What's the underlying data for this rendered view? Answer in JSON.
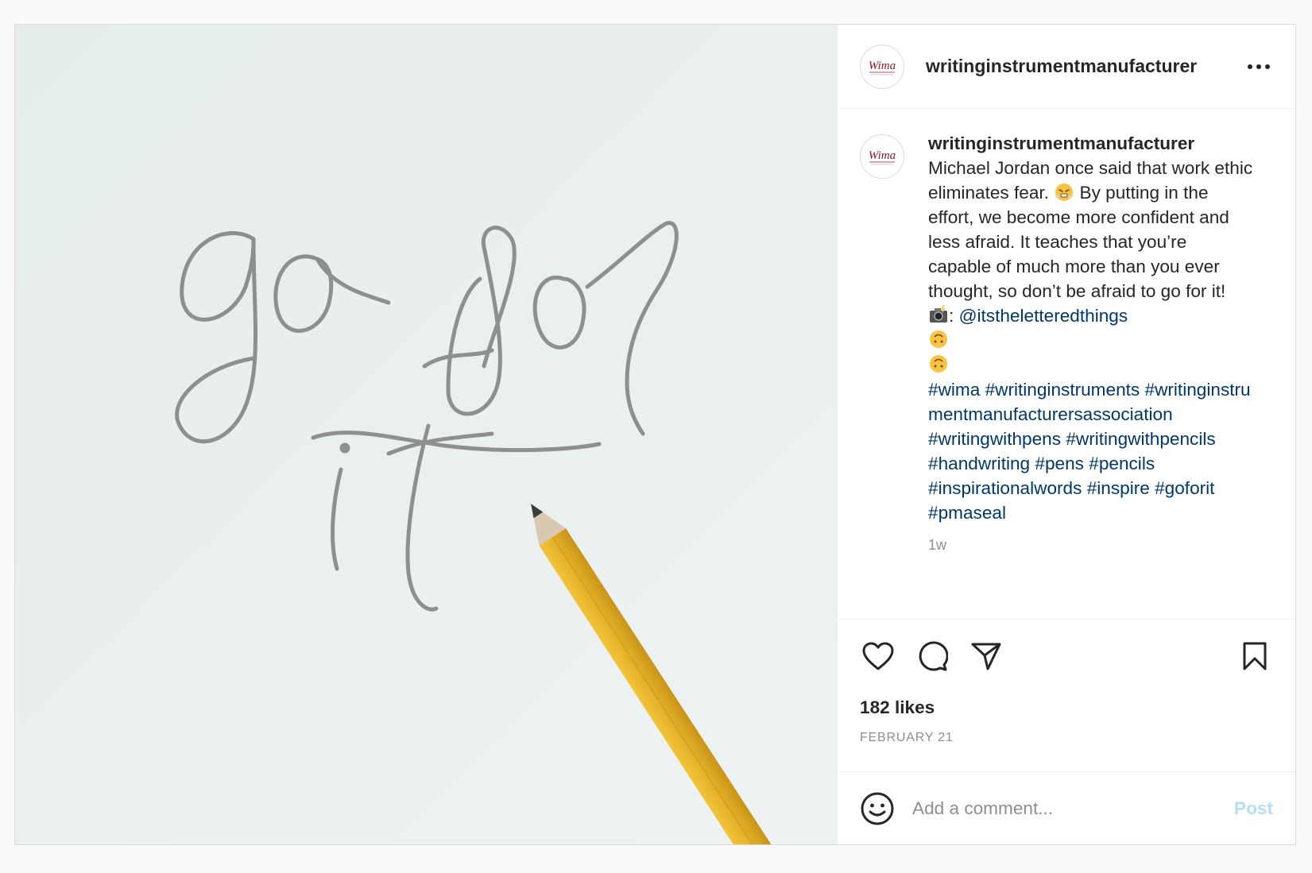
{
  "header": {
    "username": "writinginstrumentmanufacturer",
    "avatar_text": "Wima"
  },
  "caption": {
    "username": "writinginstrumentmanufacturer",
    "text_1": "Michael Jordan once said that work ethic eliminates fear.",
    "text_2": "By putting in the effort, we become more confident and less afraid. It teaches that you’re capable of much more than you ever thought, so don’t be afraid to go for it!",
    "camera_colon": ":",
    "mention": "@itstheletteredthings",
    "hashtags_line_1": [
      "#wima",
      "#writinginstruments"
    ],
    "hashtag_long": "#writinginstrumentmanufacturersassociation",
    "hashtags_line_2": [
      "#writingwithpens"
    ],
    "hashtags_line_3": [
      "#writingwithpencils",
      "#handwriting"
    ],
    "hashtags_line_4": [
      "#pens",
      "#pencils",
      "#inspirationalwords"
    ],
    "hashtags_line_5": [
      "#inspire",
      "#goforit",
      "#pmaseal"
    ],
    "time": "1w"
  },
  "actions": {
    "icons": [
      "heart-icon",
      "comment-icon",
      "share-icon",
      "bookmark-icon"
    ]
  },
  "likes": "182 likes",
  "date": "February 21",
  "comment": {
    "placeholder": "Add a comment...",
    "post_label": "Post"
  },
  "colors": {
    "link": "#00376b",
    "muted": "#8e8e8e",
    "post_button": "#b2dffc",
    "pencil": "#e8b82e"
  }
}
